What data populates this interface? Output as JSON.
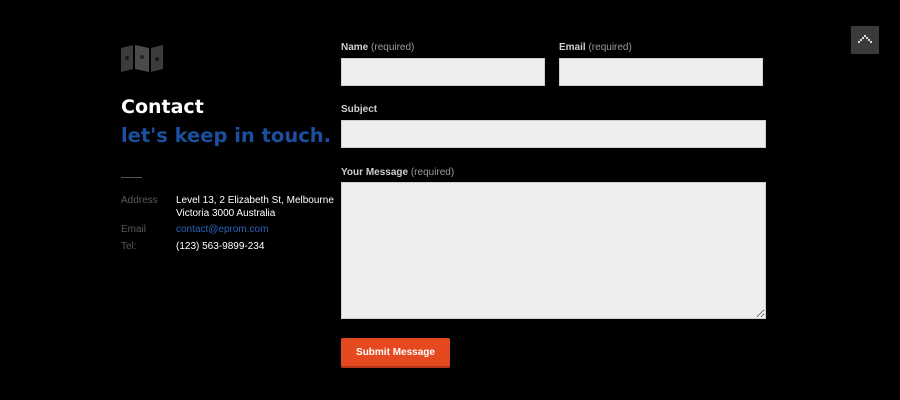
{
  "contact": {
    "heading": "Contact",
    "tagline": "let's keep in touch.",
    "address_label": "Address",
    "address_line1": "Level 13, 2 Elizabeth St, Melbourne",
    "address_line2": "Victoria 3000 Australia",
    "email_label": "Email",
    "email_value": "contact@eprom.com",
    "tel_label": "Tel:",
    "tel_value": "(123) 563-9899-234"
  },
  "form": {
    "name_label": "Name",
    "name_note": "(required)",
    "name_value": "",
    "email_label": "Email",
    "email_note": "(required)",
    "email_value": "",
    "subject_label": "Subject",
    "subject_value": "",
    "message_label": "Your Message",
    "message_note": "(required)",
    "message_value": "",
    "submit_label": "Submit Message"
  },
  "icons": {
    "logo": "map-logo-icon",
    "back_to_top": "up-arrow-icon"
  },
  "colors": {
    "background": "#000000",
    "accent_blue": "#1b4fa0",
    "link_blue": "#2a62b8",
    "submit_orange": "#e4491f",
    "field_bg": "#eeeeee"
  }
}
